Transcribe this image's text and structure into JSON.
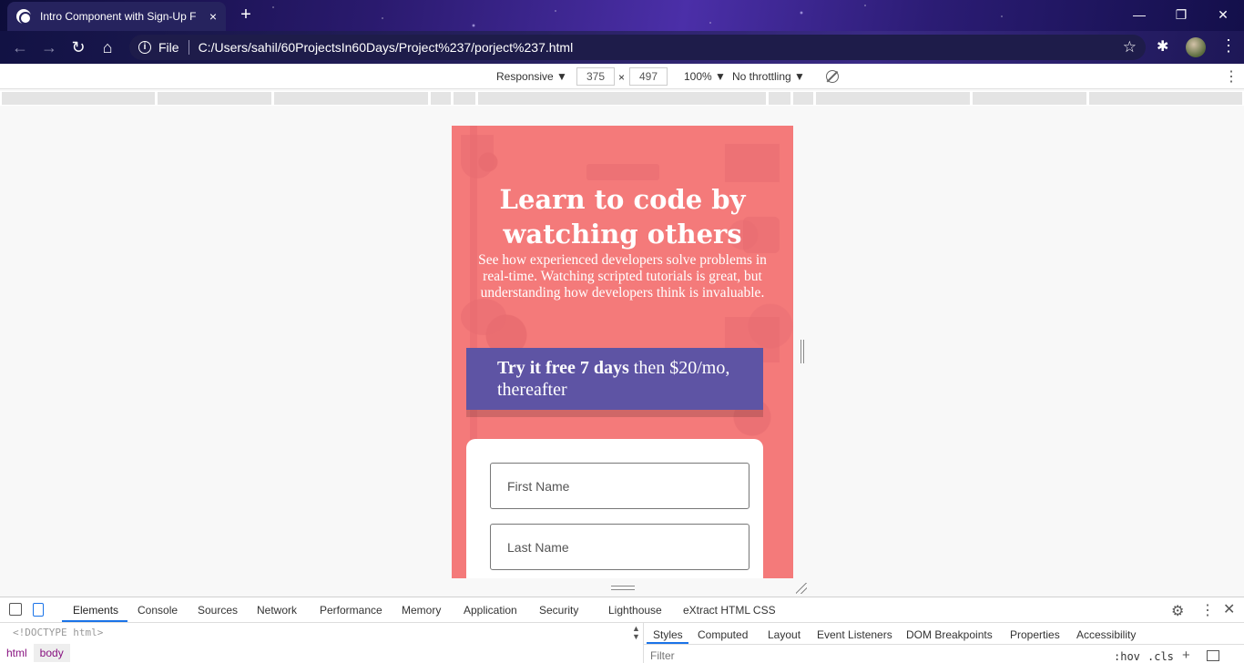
{
  "browser": {
    "tab_title": "Intro Component with Sign-Up F",
    "tab_close": "×",
    "new_tab": "+",
    "window_min": "—",
    "window_restore": "❐",
    "window_close": "✕",
    "back": "←",
    "forward": "→",
    "reload": "↻",
    "home": "⌂",
    "file_label": "File",
    "url": "C:/Users/sahil/60ProjectsIn60Days/Project%237/porject%237.html",
    "star": "☆",
    "extensions": "✱",
    "menu": "⋮"
  },
  "device_toolbar": {
    "mode": "Responsive ▼",
    "width": "375",
    "times": "×",
    "height": "497",
    "zoom": "100% ▼",
    "throttling": "No throttling ▼",
    "menu": "⋮"
  },
  "page": {
    "title": "Learn to code by watching others",
    "description": "See how experienced developers solve problems in real-time. Watching scripted tutorials is great, but understanding how developers think is invaluable.",
    "offer_bold": "Try it free 7 days",
    "offer_rest": " then $20/mo, thereafter",
    "first_name_placeholder": "First Name",
    "last_name_placeholder": "Last Name"
  },
  "devtools": {
    "tabs": [
      "Elements",
      "Console",
      "Sources",
      "Network",
      "Performance",
      "Memory",
      "Application",
      "Security",
      "Lighthouse",
      "eXtract HTML CSS"
    ],
    "doctype": "<!DOCTYPE html>",
    "breadcrumbs": [
      "html",
      "body"
    ],
    "side_tabs": [
      "Styles",
      "Computed",
      "Layout",
      "Event Listeners",
      "DOM Breakpoints",
      "Properties",
      "Accessibility"
    ],
    "filter_placeholder": "Filter",
    "hov": ":hov",
    "cls": ".cls",
    "plus": "+",
    "gear": "⚙",
    "menu": "⋮",
    "close": "✕"
  },
  "colors": {
    "page_background": "#f47a7a",
    "offer_background": "#5e54a4",
    "devtools_accent": "#1a73e8"
  }
}
